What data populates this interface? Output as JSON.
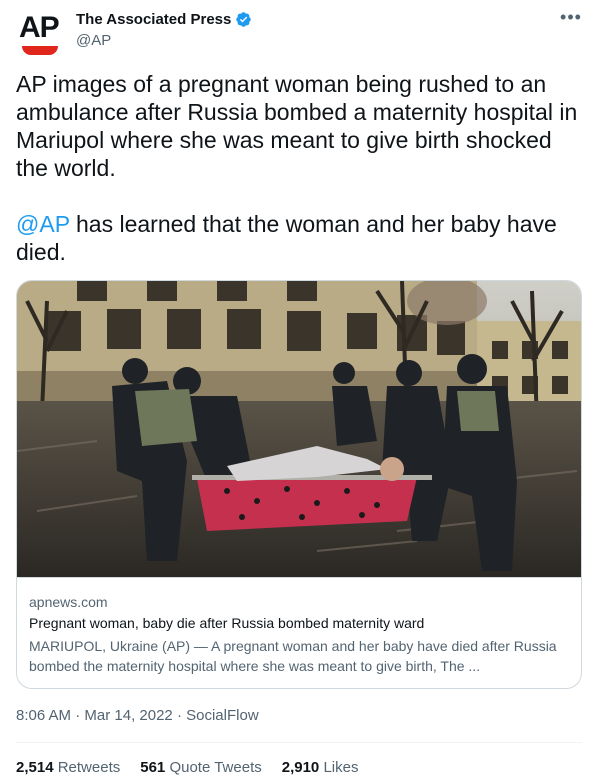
{
  "author": {
    "avatar_text": "AP",
    "display_name": "The Associated Press",
    "handle": "@AP",
    "verified": true
  },
  "tweet": {
    "paragraph1": "AP images of a pregnant woman being rushed to an ambulance after Russia bombed a maternity hospital in Mariupol where she was meant to give birth shocked the world.",
    "mention": "@AP",
    "paragraph2_rest": " has learned that the woman and her baby have died."
  },
  "card": {
    "domain": "apnews.com",
    "title": "Pregnant woman, baby die after Russia bombed maternity ward",
    "description": "MARIUPOL, Ukraine (AP) — A pregnant woman and her baby have died after Russia bombed the maternity hospital where she was meant to give birth, The ..."
  },
  "meta": {
    "time": "8:06 AM",
    "date": "Mar 14, 2022",
    "source": "SocialFlow"
  },
  "stats": {
    "retweets_count": "2,514",
    "retweets_label": "Retweets",
    "quotes_count": "561",
    "quotes_label": "Quote Tweets",
    "likes_count": "2,910",
    "likes_label": "Likes"
  },
  "colors": {
    "link": "#1d9bf0",
    "ap_red": "#e1261c",
    "secondary_text": "#536471"
  },
  "icons": {
    "verified": "verified-badge-icon",
    "more": "more-options-icon"
  }
}
